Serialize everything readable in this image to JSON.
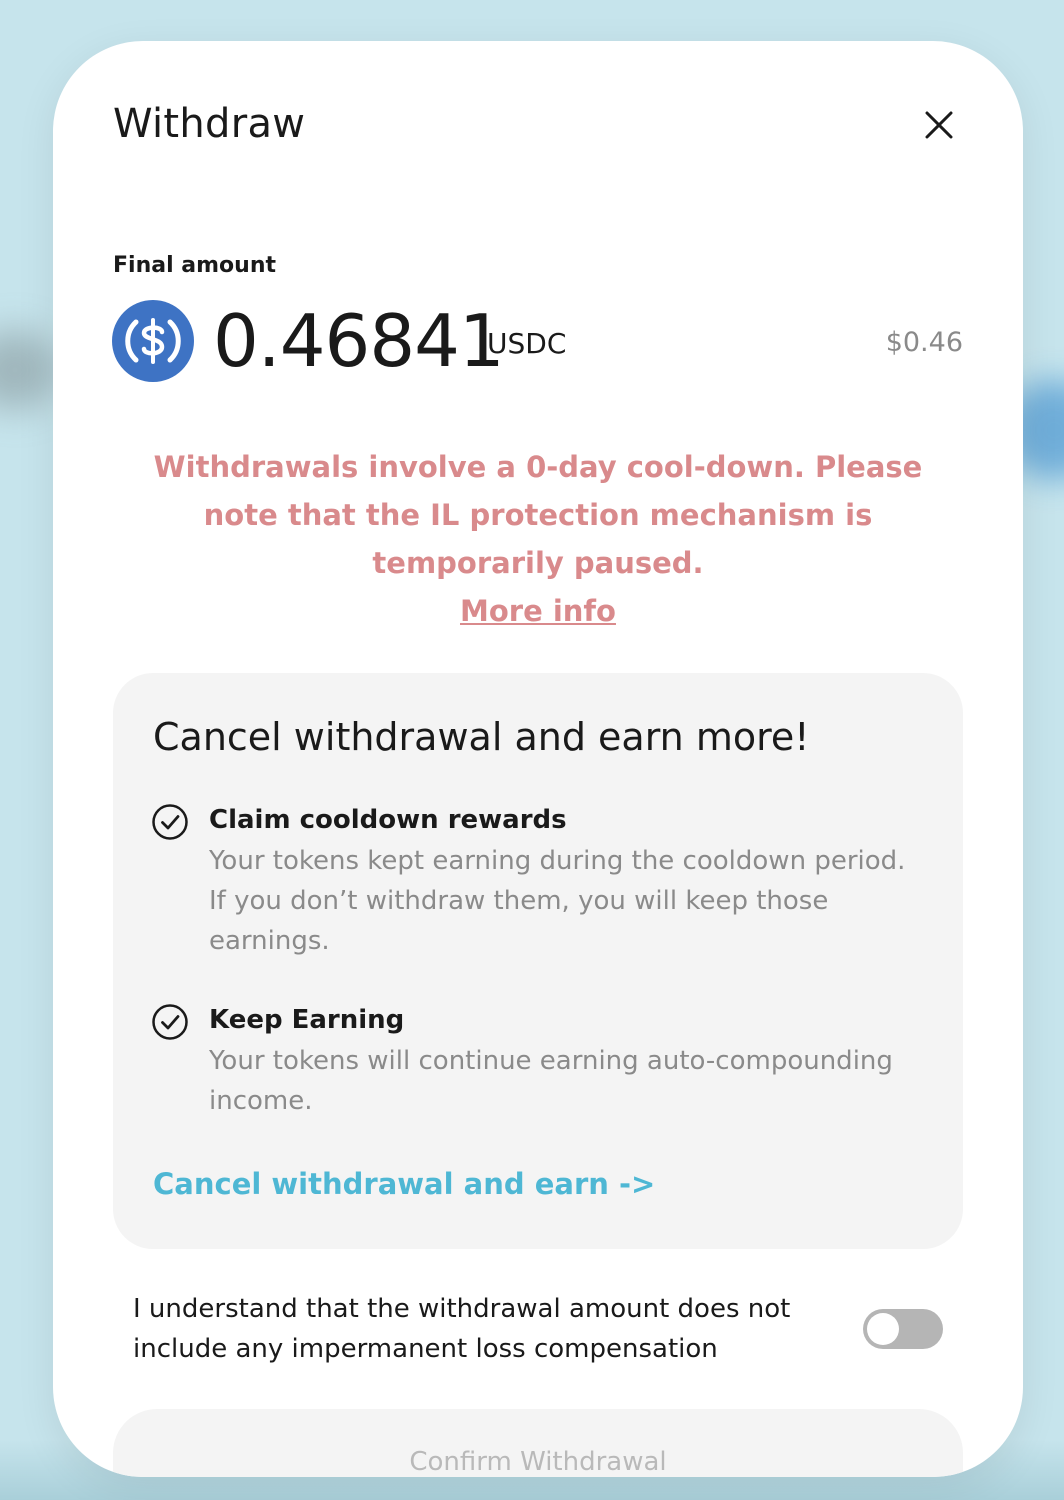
{
  "modal": {
    "title": "Withdraw",
    "close_icon": "close-icon"
  },
  "amount": {
    "label": "Final amount",
    "value": "0.46841",
    "unit": "USDC",
    "usd_value": "$0.46",
    "token_icon": "usdc-icon"
  },
  "warning": {
    "text": "Withdrawals involve a 0-day cool-down. Please note that the IL protection mechanism is temporarily paused.",
    "link_label": "More info"
  },
  "promo": {
    "title": "Cancel withdrawal and earn more!",
    "benefits": [
      {
        "icon": "check-circle-icon",
        "title": "Claim cooldown rewards",
        "description": "Your tokens kept earning during the cooldown period. If you don’t withdraw them, you will keep those earnings."
      },
      {
        "icon": "check-circle-icon",
        "title": "Keep Earning",
        "description": "Your tokens will continue earning auto-compounding income."
      }
    ],
    "cancel_link_label": "Cancel withdrawal and earn ->"
  },
  "acknowledgement": {
    "text": "I understand that the withdrawal amount does not include any impermanent loss compensation",
    "toggle_on": false
  },
  "confirm_button": {
    "label": "Confirm Withdrawal",
    "enabled": false
  },
  "colors": {
    "warning": "#d98a8c",
    "link": "#4eb7d4",
    "usdc_blue": "#3e73c4",
    "background": "#c6e4ec"
  }
}
